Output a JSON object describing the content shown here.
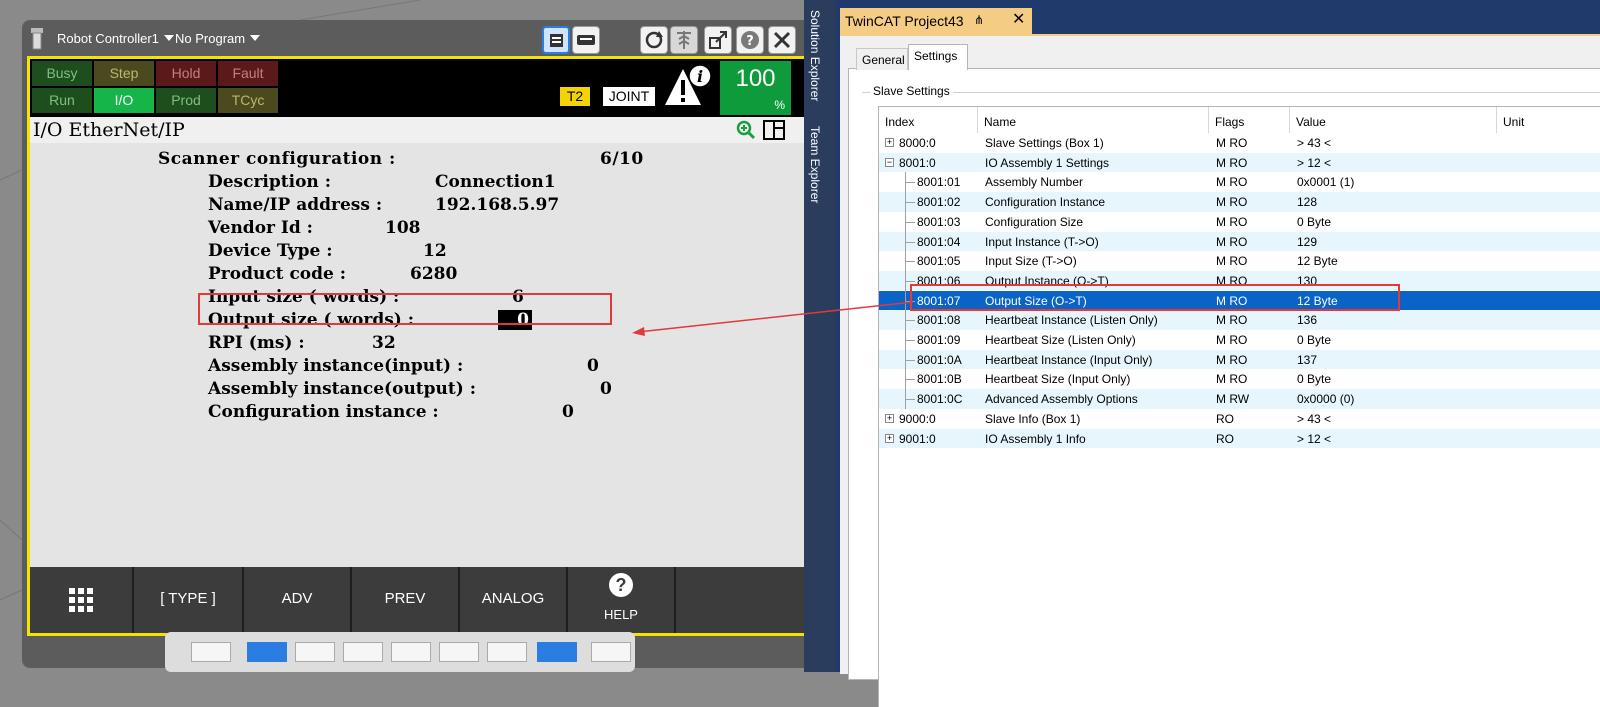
{
  "pendant": {
    "controller_label": "Robot Controller1",
    "program_label": "No Program",
    "leds_top": [
      {
        "label": "Busy",
        "bg": "#1e4d1e",
        "fg": "#7fbf7f"
      },
      {
        "label": "Step",
        "bg": "#4a4a1e",
        "fg": "#b8b870"
      },
      {
        "label": "Hold",
        "bg": "#5a1a1a",
        "fg": "#c08080"
      },
      {
        "label": "Fault",
        "bg": "#5a1a1a",
        "fg": "#c08080"
      }
    ],
    "leds_bottom": [
      {
        "label": "Run",
        "bg": "#1e4d1e",
        "fg": "#7fbf7f"
      },
      {
        "label": "I/O",
        "bg": "#15b54a",
        "fg": "#ffffff"
      },
      {
        "label": "Prod",
        "bg": "#1e4d1e",
        "fg": "#7fbf7f"
      },
      {
        "label": "TCyc",
        "bg": "#4a4a1e",
        "fg": "#b8b870"
      }
    ],
    "mode_t2": "T2",
    "mode_joint": "JOINT",
    "override_value": "100",
    "override_unit": "%",
    "screen_title": "I/O EtherNet/IP",
    "scanner_config_label": "Scanner configuration :",
    "scanner_config_index": "6/10",
    "fields": [
      {
        "label": "Description :",
        "value": "Connection1"
      },
      {
        "label": "Name/IP address :",
        "value": "192.168.5.97"
      },
      {
        "label": "Vendor Id :",
        "value": "108"
      },
      {
        "label": "Device Type :",
        "value": "12"
      },
      {
        "label": "Product code :",
        "value": "6280"
      },
      {
        "label": "Input size ( words) :",
        "value": "6"
      },
      {
        "label": "Output size ( words) :",
        "value": "0"
      },
      {
        "label": "RPI (ms) :",
        "value": "32"
      },
      {
        "label": "Assembly instance(input) :",
        "value": "0"
      },
      {
        "label": "Assembly instance(output) :",
        "value": "0"
      },
      {
        "label": "Configuration instance :",
        "value": "0"
      }
    ],
    "softkeys": [
      "[ TYPE ]",
      "ADV",
      "PREV",
      "ANALOG",
      "HELP"
    ]
  },
  "ide": {
    "side_tabs": [
      "Solution Explorer",
      "Team Explorer"
    ],
    "doc_tab_title": "TwinCAT Project43",
    "tabs": [
      "General",
      "Settings"
    ],
    "group_label": "Slave Settings",
    "columns": [
      "Index",
      "Name",
      "Flags",
      "Value",
      "Unit"
    ],
    "rows": [
      {
        "index": "8000:0",
        "name": "Slave Settings (Box 1)",
        "flags": "M RO",
        "value": "> 43 <",
        "expander": "+",
        "level": 0
      },
      {
        "index": "8001:0",
        "name": "IO Assembly 1 Settings",
        "flags": "M RO",
        "value": "> 12 <",
        "expander": "-",
        "level": 0
      },
      {
        "index": "8001:01",
        "name": "Assembly Number",
        "flags": "M RO",
        "value": "0x0001 (1)",
        "expander": "",
        "level": 1
      },
      {
        "index": "8001:02",
        "name": "Configuration Instance",
        "flags": "M RO",
        "value": "128",
        "expander": "",
        "level": 1
      },
      {
        "index": "8001:03",
        "name": "Configuration Size",
        "flags": "M RO",
        "value": "0 Byte",
        "expander": "",
        "level": 1
      },
      {
        "index": "8001:04",
        "name": "Input Instance (T->O)",
        "flags": "M RO",
        "value": "129",
        "expander": "",
        "level": 1
      },
      {
        "index": "8001:05",
        "name": "Input Size (T->O)",
        "flags": "M RO",
        "value": "12 Byte",
        "expander": "",
        "level": 1
      },
      {
        "index": "8001:06",
        "name": "Output Instance (O->T)",
        "flags": "M RO",
        "value": "130",
        "expander": "",
        "level": 1
      },
      {
        "index": "8001:07",
        "name": "Output Size (O->T)",
        "flags": "M RO",
        "value": "12 Byte",
        "expander": "",
        "level": 1,
        "selected": true
      },
      {
        "index": "8001:08",
        "name": "Heartbeat Instance (Listen Only)",
        "flags": "M RO",
        "value": "136",
        "expander": "",
        "level": 1
      },
      {
        "index": "8001:09",
        "name": "Heartbeat Size (Listen Only)",
        "flags": "M RO",
        "value": "0 Byte",
        "expander": "",
        "level": 1
      },
      {
        "index": "8001:0A",
        "name": "Heartbeat Instance (Input Only)",
        "flags": "M RO",
        "value": "137",
        "expander": "",
        "level": 1
      },
      {
        "index": "8001:0B",
        "name": "Heartbeat Size (Input Only)",
        "flags": "M RO",
        "value": "0 Byte",
        "expander": "",
        "level": 1
      },
      {
        "index": "8001:0C",
        "name": "Advanced Assembly Options",
        "flags": "M RW",
        "value": "0x0000 (0)",
        "expander": "",
        "level": 1
      },
      {
        "index": "9000:0",
        "name": "Slave Info (Box 1)",
        "flags": "RO",
        "value": "> 43 <",
        "expander": "+",
        "level": 0
      },
      {
        "index": "9001:0",
        "name": "IO Assembly 1 Info",
        "flags": "RO",
        "value": "> 12 <",
        "expander": "+",
        "level": 0
      }
    ]
  },
  "colors": {
    "highlight_box": "#e23a3a",
    "selection": "#0a63c7",
    "screen_border": "#f3e400",
    "override_bg": "#0e9b3b"
  }
}
